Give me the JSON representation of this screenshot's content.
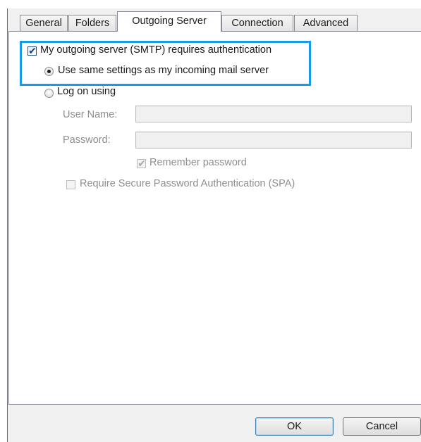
{
  "tabs": [
    {
      "label": "General",
      "active": false
    },
    {
      "label": "Folders",
      "active": false
    },
    {
      "label": "Outgoing Server",
      "active": true
    },
    {
      "label": "Connection",
      "active": false
    },
    {
      "label": "Advanced",
      "active": false
    }
  ],
  "outgoing": {
    "requires_auth": {
      "label": "My outgoing server (SMTP) requires authentication",
      "checked": true
    },
    "use_same": {
      "label": "Use same settings as my incoming mail server",
      "selected": true
    },
    "log_on": {
      "label": "Log on using",
      "selected": false
    },
    "user_name": {
      "label": "User Name:",
      "value": ""
    },
    "password": {
      "label": "Password:",
      "value": ""
    },
    "remember": {
      "label": "Remember password",
      "checked": true,
      "disabled": true
    },
    "spa": {
      "label": "Require Secure Password Authentication (SPA)",
      "checked": false,
      "disabled": true
    }
  },
  "buttons": {
    "ok": "OK",
    "cancel": "Cancel"
  },
  "colors": {
    "highlight": "#1a9be6",
    "panel": "#ffffff",
    "frame": "#f0f0f0"
  }
}
